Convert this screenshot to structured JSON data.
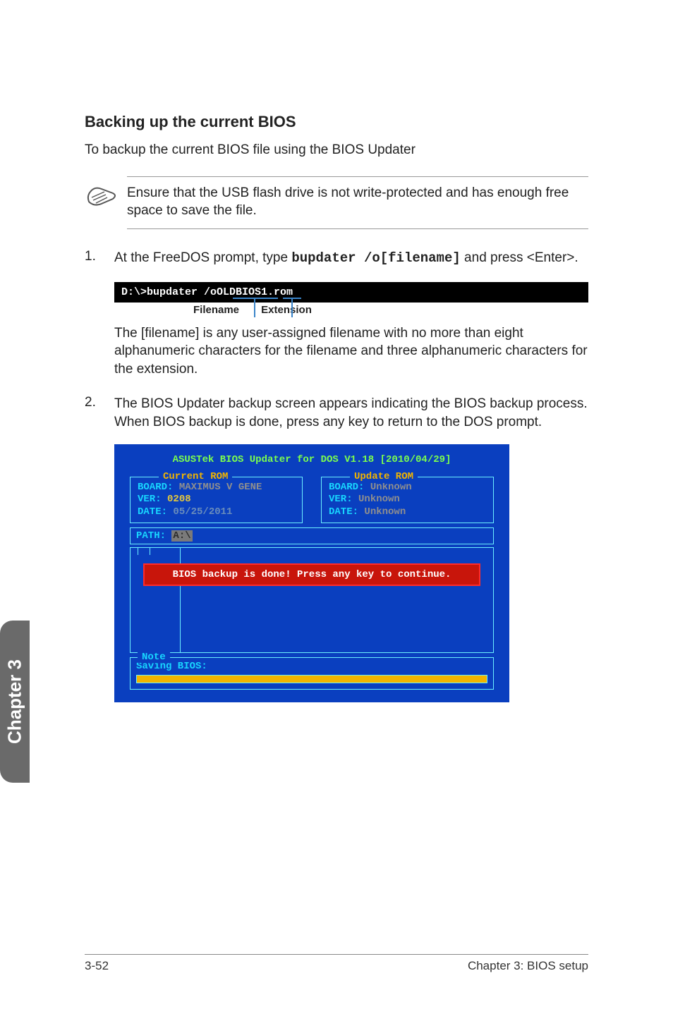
{
  "heading": "Backing up the current BIOS",
  "intro": "To backup the current BIOS file using the BIOS Updater",
  "note": "Ensure that the USB flash drive is not write-protected and has enough free space to save the file.",
  "step1": {
    "num": "1.",
    "pre": "At the FreeDOS prompt, type ",
    "cmd_inline": "bupdater /o[filename]",
    "post": " and press <Enter>.",
    "cmd_box": "D:\\>bupdater /oOLDBIOS1.rom",
    "label_filename": "Filename",
    "label_extension": "Extension",
    "subpara": "The [filename] is any user-assigned filename with no more than eight alphanumeric characters for the filename and three alphanumeric characters for the extension."
  },
  "step2": {
    "num": "2.",
    "text": "The BIOS Updater backup screen appears indicating the BIOS backup process. When BIOS backup is done, press any key to return to the DOS prompt."
  },
  "updater": {
    "title": "ASUSTek BIOS Updater for DOS V1.18 [2010/04/29]",
    "current": {
      "legend": "Current ROM",
      "board_label": "BOARD:",
      "board_val": "MAXIMUS V GENE",
      "ver_label": "VER:",
      "ver_val": "0208",
      "date_label": "DATE:",
      "date_val": "05/25/2011"
    },
    "update": {
      "legend": "Update ROM",
      "board_label": "BOARD:",
      "board_val": "Unknown",
      "ver_label": "VER:",
      "ver_val": "Unknown",
      "date_label": "DATE:",
      "date_val": "Unknown"
    },
    "path_label": "PATH:",
    "path_val": "A:\\",
    "banner": "BIOS backup is done! Press any key to continue.",
    "note_legend": "Note",
    "saving": "Saving BIOS:"
  },
  "chapter_tab": "Chapter 3",
  "footer": {
    "left": "3-52",
    "right": "Chapter 3: BIOS setup"
  }
}
